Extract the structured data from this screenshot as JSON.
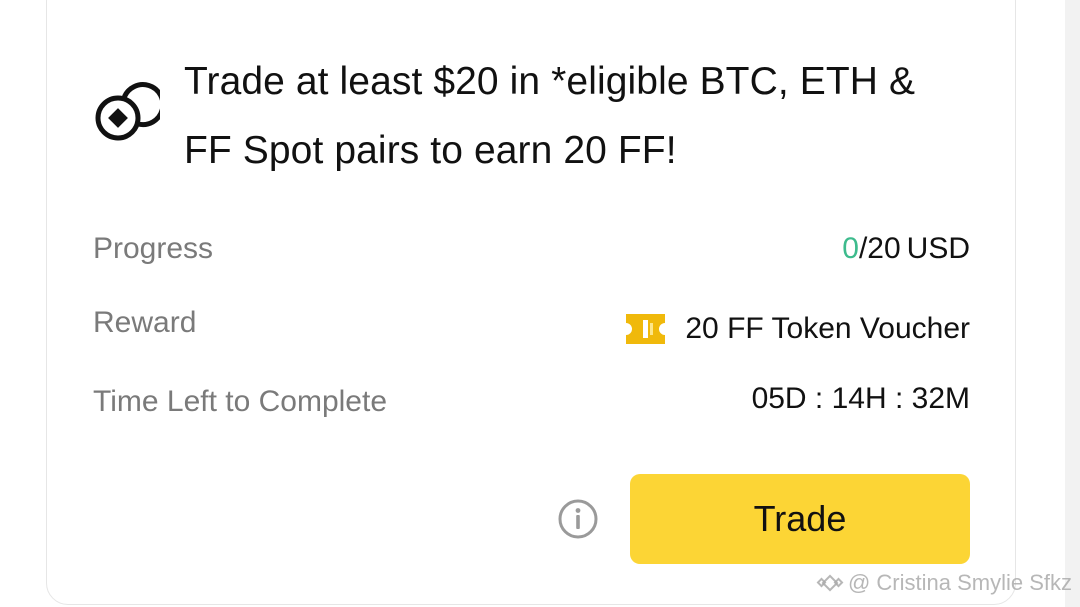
{
  "task": {
    "icon": "coin-target-icon",
    "title": "Trade at least $20 in *eligible BTC, ETH & FF Spot pairs to earn 20 FF!"
  },
  "rows": {
    "progress": {
      "label": "Progress",
      "current": "0",
      "target": "/20",
      "unit": "USD",
      "fraction": 0
    },
    "reward": {
      "label": "Reward",
      "icon": "voucher-icon",
      "value": "20 FF Token Voucher"
    },
    "time_left": {
      "label": "Time Left to Complete",
      "value": "05D : 14H : 32M"
    }
  },
  "actions": {
    "info_icon": "info-icon",
    "trade_label": "Trade"
  },
  "watermark": {
    "text": "@ Cristina Smylie Sfkz"
  },
  "colors": {
    "accent": "#fcd535",
    "progress_current": "#3dbb8d",
    "label": "#7a7a7a",
    "text": "#111111",
    "voucher": "#f0b90b"
  }
}
